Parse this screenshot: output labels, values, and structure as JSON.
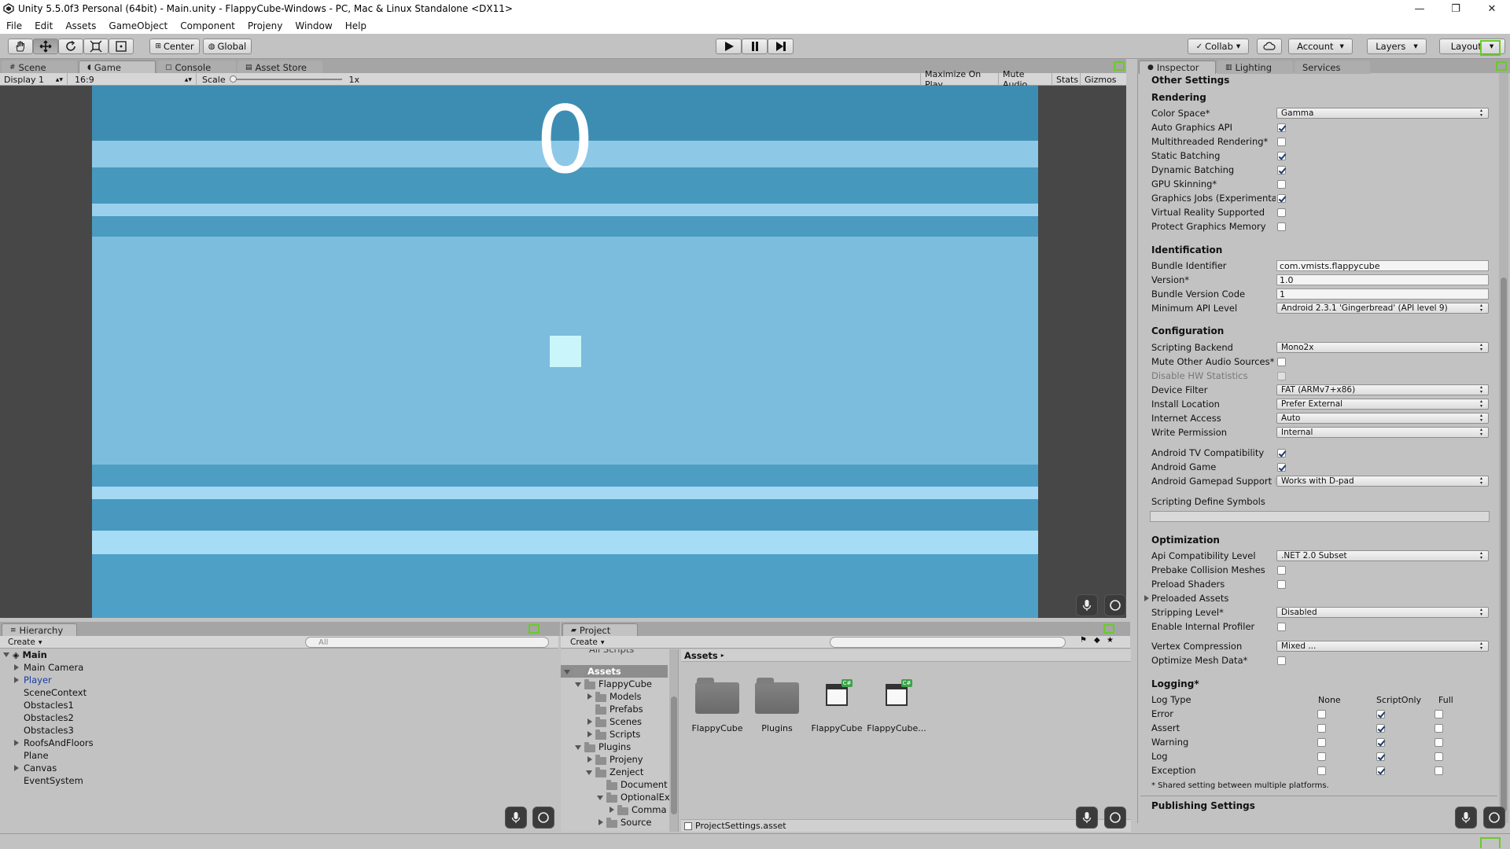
{
  "window": {
    "title": "Unity 5.5.0f3 Personal (64bit) - Main.unity - FlappyCube-Windows - PC, Mac & Linux Standalone <DX11>",
    "minimize": "—",
    "maximize": "❐",
    "close": "✕"
  },
  "menu": [
    "File",
    "Edit",
    "Assets",
    "GameObject",
    "Component",
    "Projeny",
    "Window",
    "Help"
  ],
  "toolbar": {
    "center": "Center",
    "global": "Global",
    "collab": "Collab",
    "account": "Account",
    "layers": "Layers",
    "layout": "Layout"
  },
  "left_tabs": {
    "scene": "Scene",
    "game": "Game",
    "console": "Console",
    "asset_store": "Asset Store"
  },
  "game_controls": {
    "display": "Display 1",
    "aspect": "16:9",
    "scale_label": "Scale",
    "scale_value": "1x",
    "maximize": "Maximize On Play",
    "mute": "Mute Audio",
    "stats": "Stats",
    "gizmos": "Gizmos"
  },
  "game": {
    "score": "0"
  },
  "inspector_tabs": {
    "inspector": "Inspector",
    "lighting": "Lighting",
    "services": "Services"
  },
  "inspector": {
    "section_title": "Other Settings",
    "rendering": {
      "title": "Rendering",
      "color_space": {
        "label": "Color Space*",
        "value": "Gamma"
      },
      "checks": [
        {
          "label": "Auto Graphics API",
          "checked": true
        },
        {
          "label": "Multithreaded Rendering*",
          "checked": false
        },
        {
          "label": "Static Batching",
          "checked": true
        },
        {
          "label": "Dynamic Batching",
          "checked": true
        },
        {
          "label": "GPU Skinning*",
          "checked": false
        },
        {
          "label": "Graphics Jobs (Experimenta",
          "checked": true
        },
        {
          "label": "Virtual Reality Supported",
          "checked": false
        },
        {
          "label": "Protect Graphics Memory",
          "checked": false
        }
      ]
    },
    "identification": {
      "title": "Identification",
      "bundle_id": {
        "label": "Bundle Identifier",
        "value": "com.vmists.flappycube"
      },
      "version": {
        "label": "Version*",
        "value": "1.0"
      },
      "bundle_code": {
        "label": "Bundle Version Code",
        "value": "1"
      },
      "min_api": {
        "label": "Minimum API Level",
        "value": "Android 2.3.1 'Gingerbread' (API level 9)"
      }
    },
    "configuration": {
      "title": "Configuration",
      "scripting_backend": {
        "label": "Scripting Backend",
        "value": "Mono2x"
      },
      "mute_audio": {
        "label": "Mute Other Audio Sources*"
      },
      "disable_hw": {
        "label": "Disable HW Statistics"
      },
      "device_filter": {
        "label": "Device Filter",
        "value": "FAT (ARMv7+x86)"
      },
      "install_location": {
        "label": "Install Location",
        "value": "Prefer External"
      },
      "internet_access": {
        "label": "Internet Access",
        "value": "Auto"
      },
      "write_permission": {
        "label": "Write Permission",
        "value": "Internal"
      },
      "android_tv": {
        "label": "Android TV Compatibility"
      },
      "android_game": {
        "label": "Android Game"
      },
      "gamepad": {
        "label": "Android Gamepad Support L",
        "value": "Works with D-pad"
      },
      "define_symbols": {
        "label": "Scripting Define Symbols"
      }
    },
    "optimization": {
      "title": "Optimization",
      "api_level": {
        "label": "Api Compatibility Level",
        "value": ".NET 2.0 Subset"
      },
      "prebake": {
        "label": "Prebake Collision Meshes"
      },
      "preload_shaders": {
        "label": "Preload Shaders"
      },
      "preloaded_assets": {
        "label": "Preloaded Assets"
      },
      "stripping": {
        "label": "Stripping Level*",
        "value": "Disabled"
      },
      "profiler": {
        "label": "Enable Internal Profiler"
      },
      "vertex_compression": {
        "label": "Vertex Compression",
        "value": "Mixed ..."
      },
      "optimize_mesh": {
        "label": "Optimize Mesh Data*"
      }
    },
    "logging": {
      "title": "Logging*",
      "log_type": "Log Type",
      "cols": [
        "None",
        "ScriptOnly",
        "Full"
      ],
      "rows": [
        "Error",
        "Assert",
        "Warning",
        "Log",
        "Exception"
      ],
      "note": "* Shared setting between multiple platforms."
    },
    "publishing": "Publishing Settings"
  },
  "hierarchy": {
    "tab": "Hierarchy",
    "create": "Create",
    "search_placeholder": "All",
    "scene": "Main",
    "items": [
      "Main Camera",
      "Player",
      "SceneContext",
      "Obstacles1",
      "Obstacles2",
      "Obstacles3",
      "RoofsAndFloors",
      "Plane",
      "Canvas",
      "EventSystem"
    ]
  },
  "project": {
    "tab": "Project",
    "create": "Create",
    "tree_partial": "All Scripts",
    "tree": [
      "Assets",
      "FlappyCube",
      "Models",
      "Prefabs",
      "Scenes",
      "Scripts",
      "Plugins",
      "Projeny",
      "Zenject",
      "Document",
      "OptionalEx",
      "Comma",
      "Source"
    ],
    "breadcrumb": "Assets",
    "assets": [
      "FlappyCube",
      "Plugins",
      "FlappyCube",
      "FlappyCube..."
    ],
    "selected_file": "ProjectSettings.asset"
  },
  "colors": {
    "sky": "#7cbcdd",
    "band_dark": "#3f8fb5",
    "band_light": "#9fd2ee",
    "player": "#c9f5fb"
  }
}
